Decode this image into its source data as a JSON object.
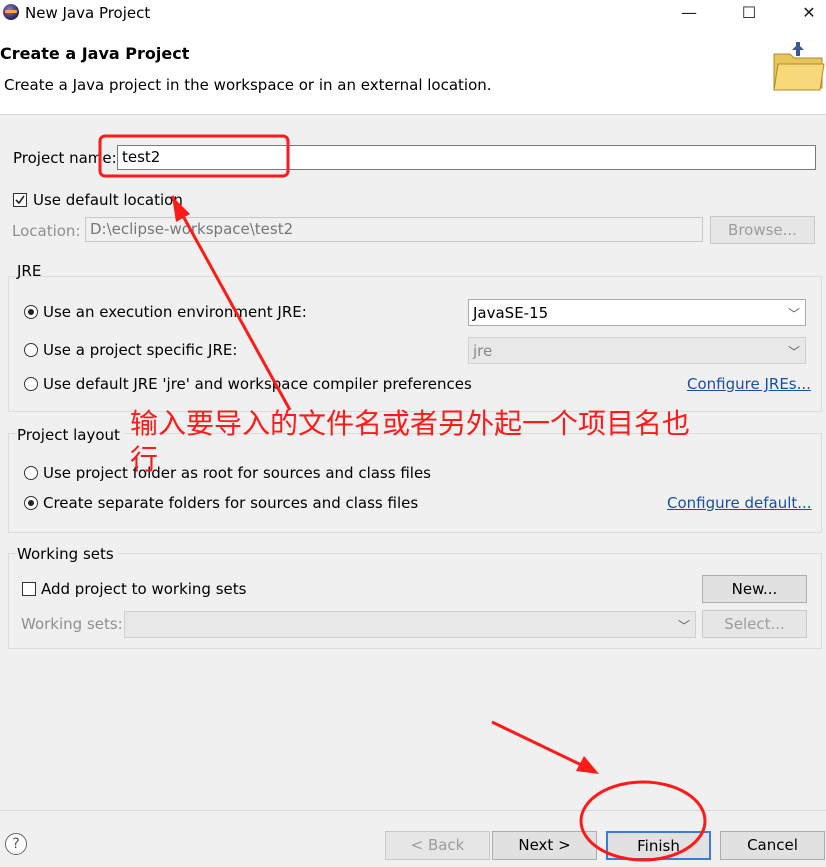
{
  "window": {
    "title": "New Java Project",
    "minimize": "—",
    "maximize": "☐",
    "close": "✕"
  },
  "header": {
    "title": "Create a Java Project",
    "description": "Create a Java project in the workspace or in an external location."
  },
  "project": {
    "name_label": "Project name:",
    "name_value": "test2"
  },
  "location": {
    "use_default_label": "Use default location",
    "use_default_checked": true,
    "label": "Location:",
    "value": "D:\\eclipse-workspace\\test2",
    "browse": "Browse..."
  },
  "jre": {
    "title": "JRE",
    "opt_env": "Use an execution environment JRE:",
    "env_value": "JavaSE-15",
    "opt_specific": "Use a project specific JRE:",
    "specific_value": "jre",
    "opt_default": "Use default JRE 'jre' and workspace compiler preferences",
    "configure": "Configure JREs..."
  },
  "layout": {
    "title": "Project layout",
    "opt_root": "Use project folder as root for sources and class files",
    "opt_separate": "Create separate folders for sources and class files",
    "configure": "Configure default..."
  },
  "working_sets": {
    "title": "Working sets",
    "add_label": "Add project to working sets",
    "new": "New...",
    "sets_label": "Working sets:",
    "select": "Select..."
  },
  "footer": {
    "help": "?",
    "back": "< Back",
    "next": "Next >",
    "finish": "Finish",
    "cancel": "Cancel"
  },
  "annotation": {
    "text_line1": "输入要导入的文件名或者另外起一个项目名也",
    "text_line2": "行",
    "color": "#ff1a1a"
  }
}
